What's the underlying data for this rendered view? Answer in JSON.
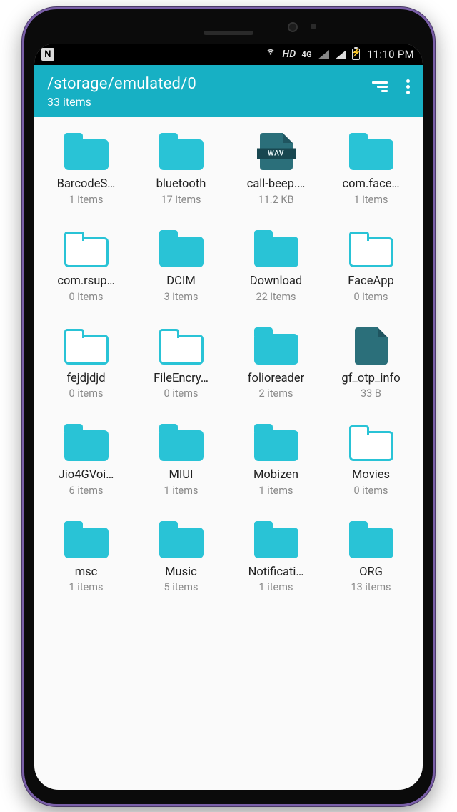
{
  "status": {
    "time": "11:10 PM",
    "hd": "HD",
    "net": "4G"
  },
  "appbar": {
    "path": "/storage/emulated/0",
    "count_label": "33 items"
  },
  "items": [
    {
      "name": "BarcodeS…",
      "meta": "1 items",
      "kind": "folder"
    },
    {
      "name": "bluetooth",
      "meta": "17 items",
      "kind": "folder"
    },
    {
      "name": "call-beep.…",
      "meta": "11.2 KB",
      "kind": "file",
      "badge": "WAV"
    },
    {
      "name": "com.face…",
      "meta": "1 items",
      "kind": "folder"
    },
    {
      "name": "com.rsup…",
      "meta": "0 items",
      "kind": "folder-empty"
    },
    {
      "name": "DCIM",
      "meta": "3 items",
      "kind": "folder"
    },
    {
      "name": "Download",
      "meta": "22 items",
      "kind": "folder"
    },
    {
      "name": "FaceApp",
      "meta": "0 items",
      "kind": "folder-empty"
    },
    {
      "name": "fejdjdjd",
      "meta": "0 items",
      "kind": "folder-empty"
    },
    {
      "name": "FileEncry…",
      "meta": "0 items",
      "kind": "folder-empty"
    },
    {
      "name": "folioreader",
      "meta": "2 items",
      "kind": "folder"
    },
    {
      "name": "gf_otp_info",
      "meta": "33 B",
      "kind": "file-plain"
    },
    {
      "name": "Jio4GVoi…",
      "meta": "6 items",
      "kind": "folder"
    },
    {
      "name": "MIUI",
      "meta": "1 items",
      "kind": "folder"
    },
    {
      "name": "Mobizen",
      "meta": "1 items",
      "kind": "folder"
    },
    {
      "name": "Movies",
      "meta": "0 items",
      "kind": "folder-empty"
    },
    {
      "name": "msc",
      "meta": "1 items",
      "kind": "folder"
    },
    {
      "name": "Music",
      "meta": "5 items",
      "kind": "folder"
    },
    {
      "name": "Notificati…",
      "meta": "1 items",
      "kind": "folder"
    },
    {
      "name": "ORG",
      "meta": "13 items",
      "kind": "folder"
    }
  ]
}
